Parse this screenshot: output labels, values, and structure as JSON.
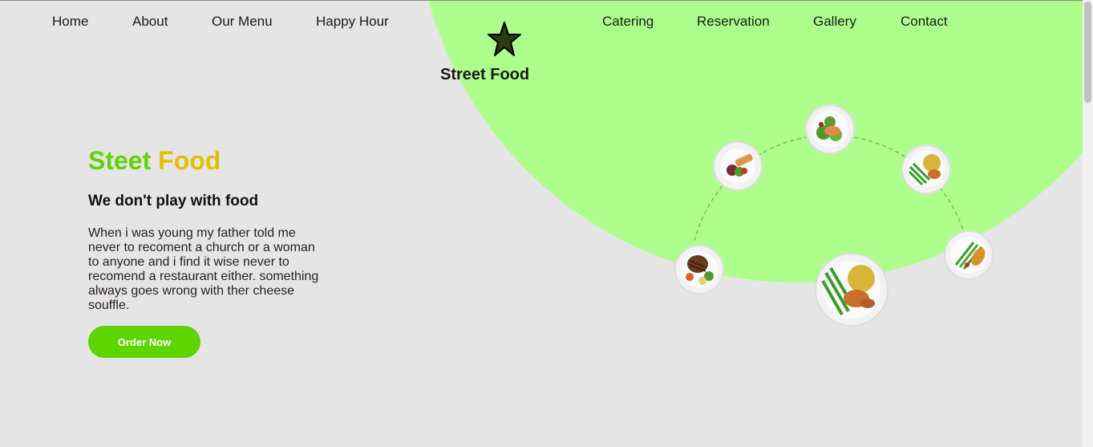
{
  "nav": {
    "left": [
      "Home",
      "About",
      "Our Menu",
      "Happy Hour"
    ],
    "right": [
      "Catering",
      "Reservation",
      "Gallery",
      "Contact"
    ]
  },
  "logo": {
    "text": "Street Food",
    "icon": "star-icon"
  },
  "hero": {
    "title_word1": "Steet",
    "title_word2": "Food",
    "subtitle": "We don't play with food",
    "body": "When i was young my father told me never to recoment a church or a woman to anyone and i find it wise never to recomend a restaurant either. something always goes wrong with ther cheese souffle.",
    "button": "Order Now"
  },
  "colors": {
    "accent_green": "#5fd400",
    "accent_yellow": "#e0c000",
    "circle_green": "#adfe8c",
    "background": "#e5e5e5"
  },
  "plates": [
    "salad-plate",
    "salmon-salad-plate",
    "green-beans-rice-plate",
    "steak-plate",
    "featured-chicken-plate",
    "asparagus-plate"
  ]
}
